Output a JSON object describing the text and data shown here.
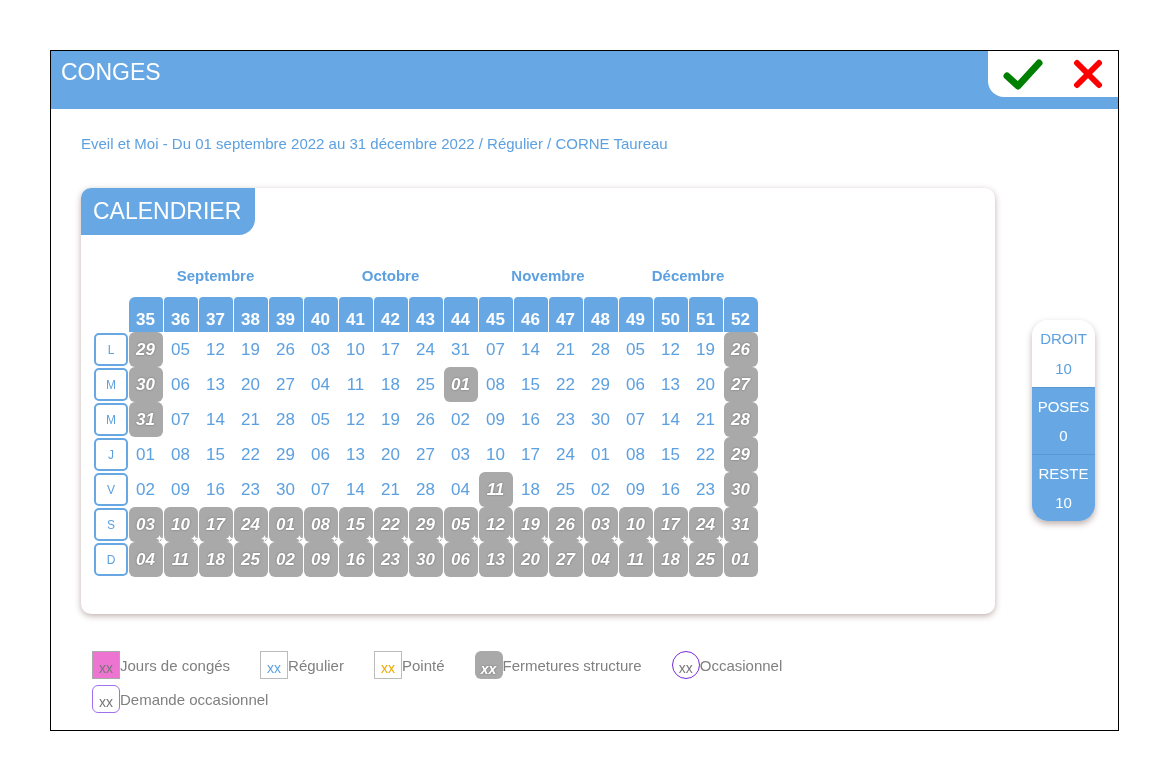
{
  "window": {
    "title": "CONGES"
  },
  "subtitle": "Eveil et Moi - Du 01 septembre 2022 au 31 décembre 2022 / Régulier / CORNE Taureau",
  "calendar": {
    "title": "CALENDRIER",
    "months": [
      "Septembre",
      "Octobre",
      "Novembre",
      "Décembre"
    ],
    "weekdays": [
      "L",
      "M",
      "M",
      "J",
      "V",
      "S",
      "D"
    ],
    "weeks": [
      {
        "week": "35",
        "days": [
          {
            "day": "29",
            "kind": "closed"
          },
          {
            "day": "30",
            "kind": "closed"
          },
          {
            "day": "31",
            "kind": "closed"
          },
          {
            "day": "01",
            "kind": "regular"
          },
          {
            "day": "02",
            "kind": "regular"
          },
          {
            "day": "03",
            "kind": "closed"
          },
          {
            "day": "04",
            "kind": "closed"
          }
        ]
      },
      {
        "week": "36",
        "days": [
          {
            "day": "05",
            "kind": "regular"
          },
          {
            "day": "06",
            "kind": "regular"
          },
          {
            "day": "07",
            "kind": "regular"
          },
          {
            "day": "08",
            "kind": "regular"
          },
          {
            "day": "09",
            "kind": "regular"
          },
          {
            "day": "10",
            "kind": "closed"
          },
          {
            "day": "11",
            "kind": "closed"
          }
        ]
      },
      {
        "week": "37",
        "days": [
          {
            "day": "12",
            "kind": "regular"
          },
          {
            "day": "13",
            "kind": "regular"
          },
          {
            "day": "14",
            "kind": "regular"
          },
          {
            "day": "15",
            "kind": "regular"
          },
          {
            "day": "16",
            "kind": "regular"
          },
          {
            "day": "17",
            "kind": "closed"
          },
          {
            "day": "18",
            "kind": "closed"
          }
        ]
      },
      {
        "week": "38",
        "days": [
          {
            "day": "19",
            "kind": "regular"
          },
          {
            "day": "20",
            "kind": "regular"
          },
          {
            "day": "21",
            "kind": "regular"
          },
          {
            "day": "22",
            "kind": "regular"
          },
          {
            "day": "23",
            "kind": "regular"
          },
          {
            "day": "24",
            "kind": "closed"
          },
          {
            "day": "25",
            "kind": "closed"
          }
        ]
      },
      {
        "week": "39",
        "days": [
          {
            "day": "26",
            "kind": "regular"
          },
          {
            "day": "27",
            "kind": "regular"
          },
          {
            "day": "28",
            "kind": "regular"
          },
          {
            "day": "29",
            "kind": "regular"
          },
          {
            "day": "30",
            "kind": "regular"
          },
          {
            "day": "01",
            "kind": "closed"
          },
          {
            "day": "02",
            "kind": "closed"
          }
        ]
      },
      {
        "week": "40",
        "days": [
          {
            "day": "03",
            "kind": "regular"
          },
          {
            "day": "04",
            "kind": "regular"
          },
          {
            "day": "05",
            "kind": "regular"
          },
          {
            "day": "06",
            "kind": "regular"
          },
          {
            "day": "07",
            "kind": "regular"
          },
          {
            "day": "08",
            "kind": "closed"
          },
          {
            "day": "09",
            "kind": "closed"
          }
        ]
      },
      {
        "week": "41",
        "days": [
          {
            "day": "10",
            "kind": "regular"
          },
          {
            "day": "11",
            "kind": "regular"
          },
          {
            "day": "12",
            "kind": "regular"
          },
          {
            "day": "13",
            "kind": "regular"
          },
          {
            "day": "14",
            "kind": "regular"
          },
          {
            "day": "15",
            "kind": "closed"
          },
          {
            "day": "16",
            "kind": "closed"
          }
        ]
      },
      {
        "week": "42",
        "days": [
          {
            "day": "17",
            "kind": "regular"
          },
          {
            "day": "18",
            "kind": "regular"
          },
          {
            "day": "19",
            "kind": "regular"
          },
          {
            "day": "20",
            "kind": "regular"
          },
          {
            "day": "21",
            "kind": "regular"
          },
          {
            "day": "22",
            "kind": "closed"
          },
          {
            "day": "23",
            "kind": "closed"
          }
        ]
      },
      {
        "week": "43",
        "days": [
          {
            "day": "24",
            "kind": "regular"
          },
          {
            "day": "25",
            "kind": "regular"
          },
          {
            "day": "26",
            "kind": "regular"
          },
          {
            "day": "27",
            "kind": "regular"
          },
          {
            "day": "28",
            "kind": "regular"
          },
          {
            "day": "29",
            "kind": "closed"
          },
          {
            "day": "30",
            "kind": "closed"
          }
        ]
      },
      {
        "week": "44",
        "days": [
          {
            "day": "31",
            "kind": "regular"
          },
          {
            "day": "01",
            "kind": "closed"
          },
          {
            "day": "02",
            "kind": "regular"
          },
          {
            "day": "03",
            "kind": "regular"
          },
          {
            "day": "04",
            "kind": "regular"
          },
          {
            "day": "05",
            "kind": "closed"
          },
          {
            "day": "06",
            "kind": "closed"
          }
        ]
      },
      {
        "week": "45",
        "days": [
          {
            "day": "07",
            "kind": "regular"
          },
          {
            "day": "08",
            "kind": "regular"
          },
          {
            "day": "09",
            "kind": "regular"
          },
          {
            "day": "10",
            "kind": "regular"
          },
          {
            "day": "11",
            "kind": "closed"
          },
          {
            "day": "12",
            "kind": "closed"
          },
          {
            "day": "13",
            "kind": "closed"
          }
        ]
      },
      {
        "week": "46",
        "days": [
          {
            "day": "14",
            "kind": "regular"
          },
          {
            "day": "15",
            "kind": "regular"
          },
          {
            "day": "16",
            "kind": "regular"
          },
          {
            "day": "17",
            "kind": "regular"
          },
          {
            "day": "18",
            "kind": "regular"
          },
          {
            "day": "19",
            "kind": "closed"
          },
          {
            "day": "20",
            "kind": "closed"
          }
        ]
      },
      {
        "week": "47",
        "days": [
          {
            "day": "21",
            "kind": "regular"
          },
          {
            "day": "22",
            "kind": "regular"
          },
          {
            "day": "23",
            "kind": "regular"
          },
          {
            "day": "24",
            "kind": "regular"
          },
          {
            "day": "25",
            "kind": "regular"
          },
          {
            "day": "26",
            "kind": "closed"
          },
          {
            "day": "27",
            "kind": "closed"
          }
        ]
      },
      {
        "week": "48",
        "days": [
          {
            "day": "28",
            "kind": "regular"
          },
          {
            "day": "29",
            "kind": "regular"
          },
          {
            "day": "30",
            "kind": "regular"
          },
          {
            "day": "01",
            "kind": "regular"
          },
          {
            "day": "02",
            "kind": "regular"
          },
          {
            "day": "03",
            "kind": "closed"
          },
          {
            "day": "04",
            "kind": "closed"
          }
        ]
      },
      {
        "week": "49",
        "days": [
          {
            "day": "05",
            "kind": "regular"
          },
          {
            "day": "06",
            "kind": "regular"
          },
          {
            "day": "07",
            "kind": "regular"
          },
          {
            "day": "08",
            "kind": "regular"
          },
          {
            "day": "09",
            "kind": "regular"
          },
          {
            "day": "10",
            "kind": "closed"
          },
          {
            "day": "11",
            "kind": "closed"
          }
        ]
      },
      {
        "week": "50",
        "days": [
          {
            "day": "12",
            "kind": "regular"
          },
          {
            "day": "13",
            "kind": "regular"
          },
          {
            "day": "14",
            "kind": "regular"
          },
          {
            "day": "15",
            "kind": "regular"
          },
          {
            "day": "16",
            "kind": "regular"
          },
          {
            "day": "17",
            "kind": "closed"
          },
          {
            "day": "18",
            "kind": "closed"
          }
        ]
      },
      {
        "week": "51",
        "days": [
          {
            "day": "19",
            "kind": "regular"
          },
          {
            "day": "20",
            "kind": "regular"
          },
          {
            "day": "21",
            "kind": "regular"
          },
          {
            "day": "22",
            "kind": "regular"
          },
          {
            "day": "23",
            "kind": "regular"
          },
          {
            "day": "24",
            "kind": "closed"
          },
          {
            "day": "25",
            "kind": "closed"
          }
        ]
      },
      {
        "week": "52",
        "days": [
          {
            "day": "26",
            "kind": "closed"
          },
          {
            "day": "27",
            "kind": "closed"
          },
          {
            "day": "28",
            "kind": "closed"
          },
          {
            "day": "29",
            "kind": "closed"
          },
          {
            "day": "30",
            "kind": "closed"
          },
          {
            "day": "31",
            "kind": "closed"
          },
          {
            "day": "01",
            "kind": "closed"
          }
        ]
      }
    ]
  },
  "counters": [
    {
      "label": "DROIT",
      "value": "10",
      "kind": "plain"
    },
    {
      "label": "POSES",
      "value": "0",
      "kind": "filled"
    },
    {
      "label": "RESTE",
      "value": "10",
      "kind": "filled"
    }
  ],
  "legend": [
    {
      "sample": "xx",
      "label": "Jours de congés",
      "kind": "leave"
    },
    {
      "sample": "xx",
      "label": "Régulier",
      "kind": "regular"
    },
    {
      "sample": "xx",
      "label": "Pointé",
      "kind": "clocked"
    },
    {
      "sample": "xx",
      "label": "Fermetures structure",
      "kind": "closed"
    },
    {
      "sample": "xx",
      "label": "Occasionnel",
      "kind": "occasional"
    },
    {
      "sample": "xx",
      "label": "Demande occasionnel",
      "kind": "request"
    }
  ]
}
